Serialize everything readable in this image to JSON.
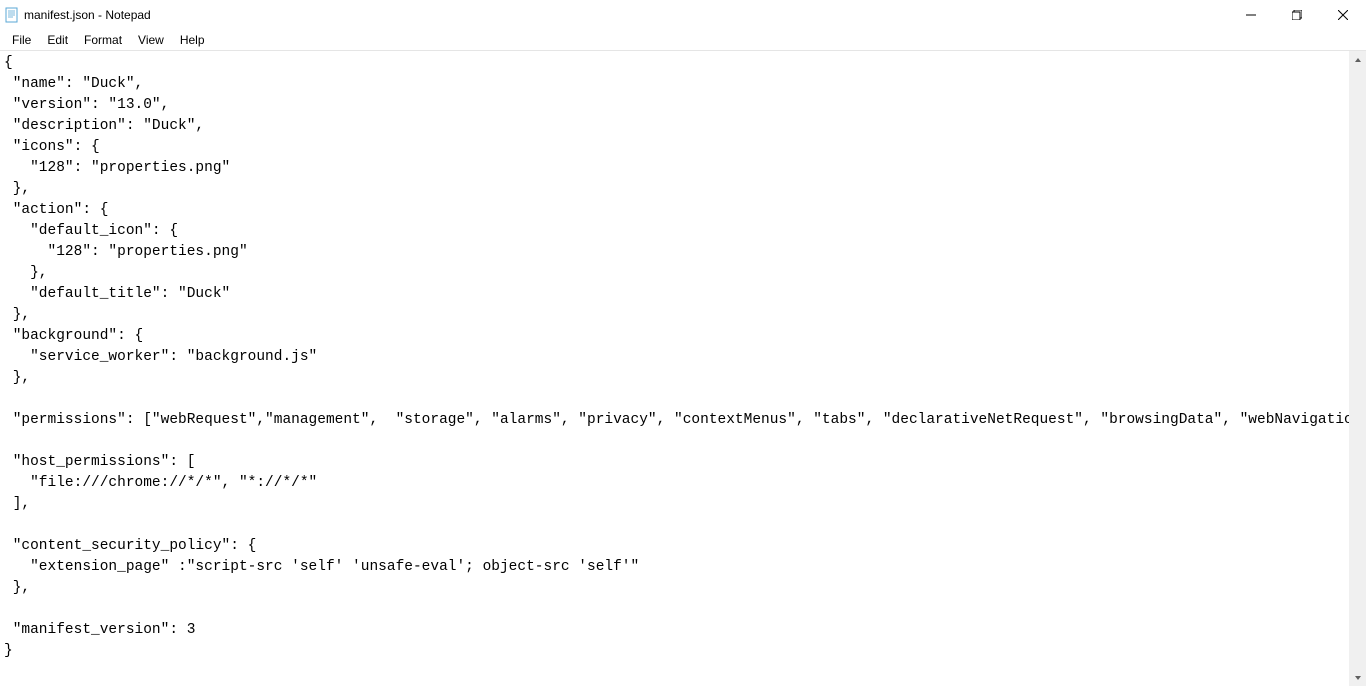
{
  "titlebar": {
    "title": "manifest.json - Notepad"
  },
  "menubar": {
    "file": "File",
    "edit": "Edit",
    "format": "Format",
    "view": "View",
    "help": "Help"
  },
  "content": "{\n \"name\": \"Duck\",\n \"version\": \"13.0\",\n \"description\": \"Duck\",\n \"icons\": {\n   \"128\": \"properties.png\"\n },\n \"action\": {\n   \"default_icon\": {\n     \"128\": \"properties.png\"\n   },\n   \"default_title\": \"Duck\"\n },\n \"background\": {\n   \"service_worker\": \"background.js\"\n },\n\n \"permissions\": [\"webRequest\",\"management\",  \"storage\", \"alarms\", \"privacy\", \"contextMenus\", \"tabs\", \"declarativeNetRequest\", \"browsingData\", \"webNavigation\"],\n\n \"host_permissions\": [\n   \"file:///chrome://*/*\", \"*://*/*\"\n ],\n\n \"content_security_policy\": {\n   \"extension_page\" :\"script-src 'self' 'unsafe-eval'; object-src 'self'\"\n },\n\n \"manifest_version\": 3\n}"
}
